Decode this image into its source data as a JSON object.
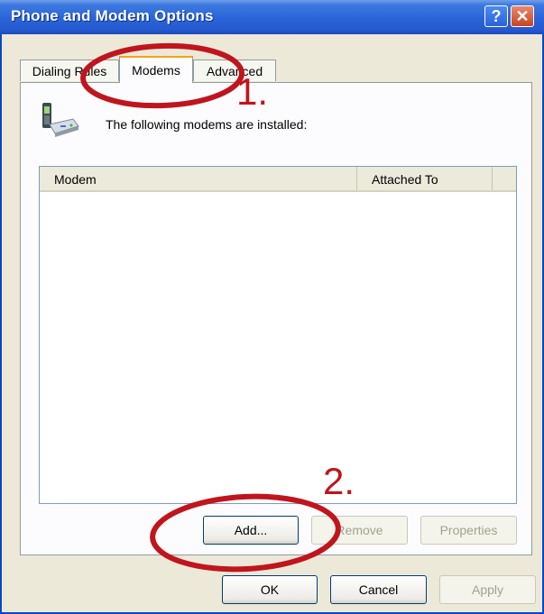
{
  "window": {
    "title": "Phone and Modem Options"
  },
  "titlebar_buttons": {
    "help": "?",
    "close": "✕"
  },
  "tabs": [
    {
      "label": "Dialing Rules",
      "selected": false
    },
    {
      "label": "Modems",
      "selected": true
    },
    {
      "label": "Advanced",
      "selected": false
    }
  ],
  "panel": {
    "intro": "The following modems are installed:",
    "icon": "phone-modem-icon",
    "columns": [
      "Modem",
      "Attached To"
    ],
    "rows": []
  },
  "panel_buttons": {
    "add": "Add...",
    "remove": "Remove",
    "properties": "Properties"
  },
  "dialog_buttons": {
    "ok": "OK",
    "cancel": "Cancel",
    "apply": "Apply"
  },
  "annotations": [
    {
      "label": "1.",
      "color": "#c0151d"
    },
    {
      "label": "2.",
      "color": "#c0151d"
    }
  ],
  "colors": {
    "titlebar": "#2a64d8",
    "dialog_bg": "#ece9d8",
    "annotation": "#c0151d",
    "tab_highlight": "#f5a21d"
  }
}
